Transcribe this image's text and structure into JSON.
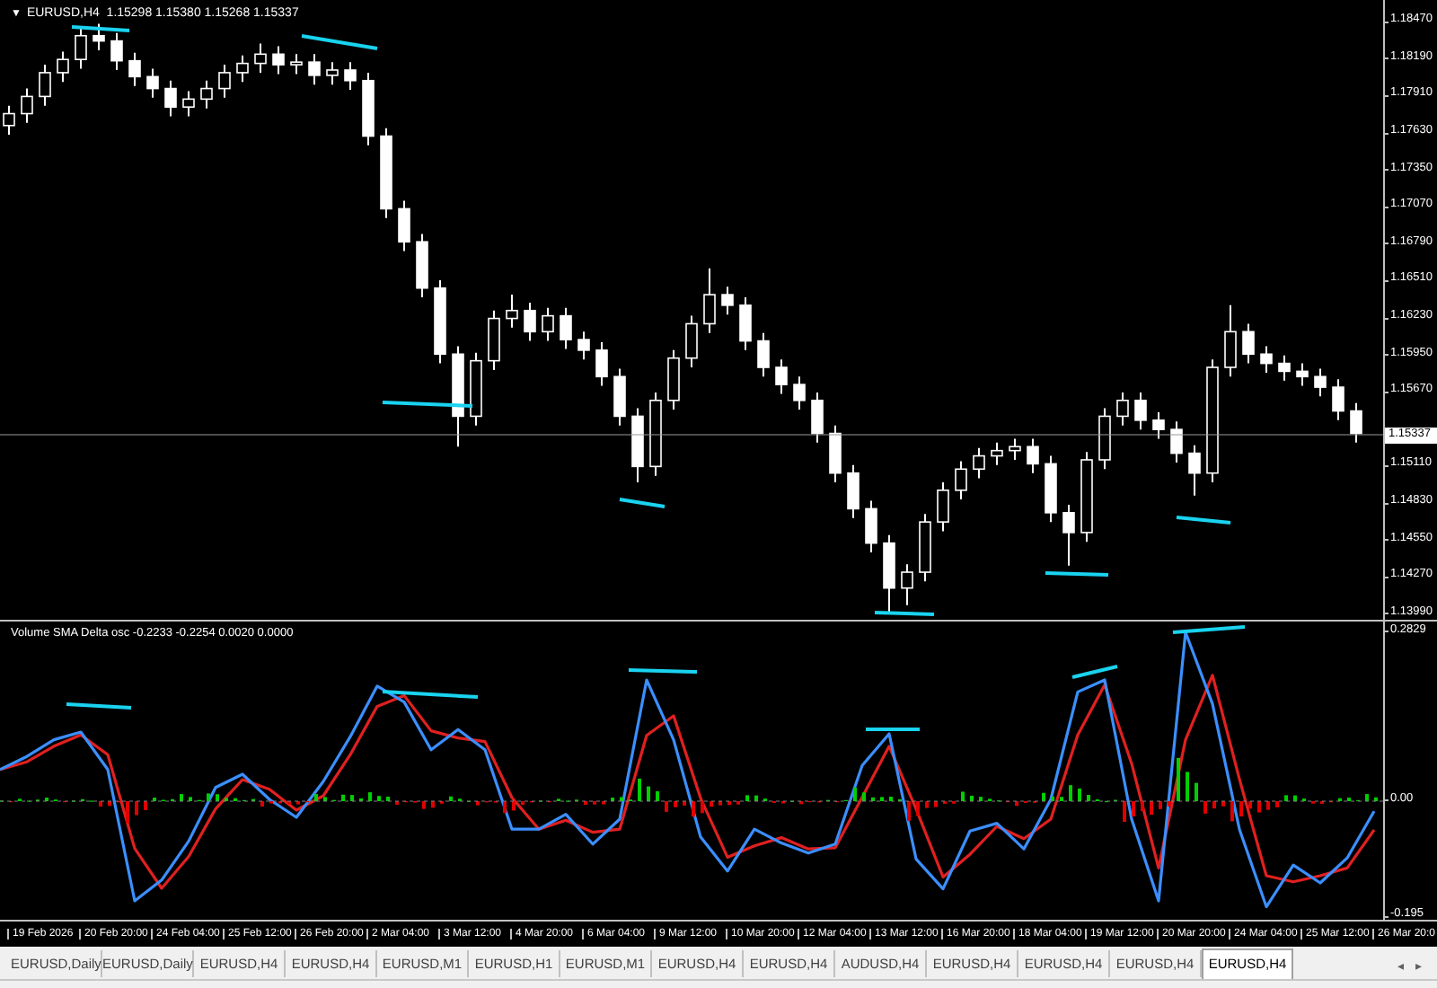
{
  "chart": {
    "symbol_caret": "▼",
    "header": "EURUSD,H4  1.15298 1.15380 1.15268 1.15337",
    "current_price": "1.15337",
    "chart_data": {
      "type": "candlestick",
      "ylim": [
        1.1394,
        1.1863
      ],
      "yticks": [
        {
          "value": 1.1847,
          "label": "1.18470"
        },
        {
          "value": 1.1819,
          "label": "1.18190"
        },
        {
          "value": 1.1791,
          "label": "1.17910"
        },
        {
          "value": 1.1763,
          "label": "1.17630"
        },
        {
          "value": 1.1735,
          "label": "1.17350"
        },
        {
          "value": 1.1707,
          "label": "1.17070"
        },
        {
          "value": 1.1679,
          "label": "1.16790"
        },
        {
          "value": 1.1651,
          "label": "1.16510"
        },
        {
          "value": 1.1623,
          "label": "1.16230"
        },
        {
          "value": 1.1595,
          "label": "1.15950"
        },
        {
          "value": 1.1567,
          "label": "1.15670"
        },
        {
          "value": 1.1511,
          "label": "1.15110"
        },
        {
          "value": 1.1483,
          "label": "1.14830"
        },
        {
          "value": 1.1455,
          "label": "1.14550"
        },
        {
          "value": 1.1427,
          "label": "1.14270"
        },
        {
          "value": 1.1399,
          "label": "1.13990"
        }
      ],
      "ohlc": [
        [
          1.1768,
          1.1783,
          1.1761,
          1.1777
        ],
        [
          1.1777,
          1.1796,
          1.177,
          1.179
        ],
        [
          1.179,
          1.1814,
          1.1783,
          1.1808
        ],
        [
          1.1808,
          1.1824,
          1.1801,
          1.1818
        ],
        [
          1.1818,
          1.1842,
          1.1811,
          1.1836
        ],
        [
          1.1836,
          1.1845,
          1.1825,
          1.1832
        ],
        [
          1.1832,
          1.1838,
          1.181,
          1.1817
        ],
        [
          1.1817,
          1.1823,
          1.1798,
          1.1805
        ],
        [
          1.1805,
          1.1811,
          1.1789,
          1.1796
        ],
        [
          1.1796,
          1.1802,
          1.1775,
          1.1782
        ],
        [
          1.1782,
          1.1794,
          1.1775,
          1.1788
        ],
        [
          1.1788,
          1.1802,
          1.1781,
          1.1796
        ],
        [
          1.1796,
          1.1814,
          1.1789,
          1.1808
        ],
        [
          1.1808,
          1.1821,
          1.1801,
          1.1815
        ],
        [
          1.1815,
          1.183,
          1.1808,
          1.1822
        ],
        [
          1.1822,
          1.1828,
          1.1807,
          1.1814
        ],
        [
          1.1814,
          1.1822,
          1.1807,
          1.1816
        ],
        [
          1.1816,
          1.1822,
          1.1799,
          1.1806
        ],
        [
          1.1806,
          1.1816,
          1.1799,
          1.181
        ],
        [
          1.181,
          1.1816,
          1.1795,
          1.1802
        ],
        [
          1.1802,
          1.1808,
          1.1753,
          1.176
        ],
        [
          1.176,
          1.1766,
          1.1698,
          1.1705
        ],
        [
          1.1705,
          1.1711,
          1.1673,
          1.168
        ],
        [
          1.168,
          1.1686,
          1.1638,
          1.1645
        ],
        [
          1.1645,
          1.1651,
          1.1588,
          1.1595
        ],
        [
          1.1595,
          1.1601,
          1.1525,
          1.1548
        ],
        [
          1.1548,
          1.1596,
          1.1541,
          1.159
        ],
        [
          1.159,
          1.1628,
          1.1583,
          1.1622
        ],
        [
          1.1622,
          1.164,
          1.1615,
          1.1628
        ],
        [
          1.1628,
          1.1634,
          1.1605,
          1.1612
        ],
        [
          1.1612,
          1.163,
          1.1605,
          1.1624
        ],
        [
          1.1624,
          1.163,
          1.1599,
          1.1606
        ],
        [
          1.1606,
          1.1612,
          1.1591,
          1.1598
        ],
        [
          1.1598,
          1.1604,
          1.1571,
          1.1578
        ],
        [
          1.1578,
          1.1584,
          1.1541,
          1.1548
        ],
        [
          1.1548,
          1.1554,
          1.1498,
          1.151
        ],
        [
          1.151,
          1.1566,
          1.1503,
          1.156
        ],
        [
          1.156,
          1.1598,
          1.1553,
          1.1592
        ],
        [
          1.1592,
          1.1624,
          1.1585,
          1.1618
        ],
        [
          1.1618,
          1.166,
          1.1611,
          1.164
        ],
        [
          1.164,
          1.1646,
          1.1625,
          1.1632
        ],
        [
          1.1632,
          1.1638,
          1.1598,
          1.1605
        ],
        [
          1.1605,
          1.1611,
          1.1578,
          1.1585
        ],
        [
          1.1585,
          1.1591,
          1.1565,
          1.1572
        ],
        [
          1.1572,
          1.1578,
          1.1553,
          1.156
        ],
        [
          1.156,
          1.1566,
          1.1528,
          1.1535
        ],
        [
          1.1535,
          1.1541,
          1.1498,
          1.1505
        ],
        [
          1.1505,
          1.1511,
          1.1471,
          1.1478
        ],
        [
          1.1478,
          1.1484,
          1.1445,
          1.1452
        ],
        [
          1.1452,
          1.1458,
          1.14,
          1.1418
        ],
        [
          1.1418,
          1.1436,
          1.1405,
          1.143
        ],
        [
          1.143,
          1.1474,
          1.1423,
          1.1468
        ],
        [
          1.1468,
          1.1498,
          1.1461,
          1.1492
        ],
        [
          1.1492,
          1.1514,
          1.1485,
          1.1508
        ],
        [
          1.1508,
          1.1524,
          1.1501,
          1.1518
        ],
        [
          1.1518,
          1.1528,
          1.1511,
          1.1522
        ],
        [
          1.1522,
          1.1531,
          1.1515,
          1.1525
        ],
        [
          1.1525,
          1.1531,
          1.1505,
          1.1512
        ],
        [
          1.1512,
          1.1518,
          1.1468,
          1.1475
        ],
        [
          1.1475,
          1.1481,
          1.1435,
          1.146
        ],
        [
          1.146,
          1.1521,
          1.1453,
          1.1515
        ],
        [
          1.1515,
          1.1554,
          1.1508,
          1.1548
        ],
        [
          1.1548,
          1.1566,
          1.1541,
          1.156
        ],
        [
          1.156,
          1.1566,
          1.1538,
          1.1545
        ],
        [
          1.1545,
          1.1551,
          1.1531,
          1.1538
        ],
        [
          1.1538,
          1.1544,
          1.1513,
          1.152
        ],
        [
          1.152,
          1.1526,
          1.1488,
          1.1505
        ],
        [
          1.1505,
          1.1591,
          1.1498,
          1.1585
        ],
        [
          1.1585,
          1.1632,
          1.1578,
          1.1612
        ],
        [
          1.1612,
          1.1618,
          1.1588,
          1.1595
        ],
        [
          1.1595,
          1.1601,
          1.1581,
          1.1588
        ],
        [
          1.1588,
          1.1594,
          1.1575,
          1.1582
        ],
        [
          1.1582,
          1.1588,
          1.1571,
          1.1578
        ],
        [
          1.1578,
          1.1584,
          1.1563,
          1.157
        ],
        [
          1.157,
          1.1576,
          1.1545,
          1.1552
        ],
        [
          1.1552,
          1.1558,
          1.1528,
          1.1535
        ]
      ]
    }
  },
  "indicator": {
    "header": "Volume SMA Delta osc -0.2233 -0.2254 0.0020 0.0000",
    "chart_data": {
      "type": "line",
      "ylim": [
        -0.195,
        0.2829
      ],
      "yticks": [
        {
          "value": 0.2829,
          "label": "0.2829"
        },
        {
          "value": 0,
          "label": "0.00"
        },
        {
          "value": -0.195,
          "label": "-0.195"
        }
      ],
      "series": [
        {
          "color": "#e02020",
          "values": [
            0.05,
            0.063,
            0.089,
            0.108,
            0.075,
            -0.082,
            -0.149,
            -0.096,
            -0.016,
            0.033,
            0.017,
            -0.018,
            0.006,
            0.075,
            0.156,
            0.174,
            0.115,
            0.103,
            0.097,
            0.003,
            -0.05,
            -0.035,
            -0.055,
            -0.05,
            0.107,
            0.14,
            0.002,
            -0.097,
            -0.078,
            -0.064,
            -0.083,
            -0.081,
            0.004,
            0.089,
            -0.016,
            -0.13,
            -0.092,
            -0.045,
            -0.066,
            -0.033,
            0.108,
            0.192,
            0.06,
            -0.115,
            0.1,
            0.208,
            0.034,
            -0.128,
            -0.138,
            -0.128,
            -0.115,
            -0.051
          ]
        },
        {
          "color": "#3b8fff",
          "values": [
            0.05,
            0.072,
            0.1,
            0.113,
            0.05,
            -0.17,
            -0.135,
            -0.07,
            0.02,
            0.042,
            0,
            -0.03,
            0.03,
            0.105,
            0.19,
            0.163,
            0.083,
            0.117,
            0.083,
            -0.05,
            -0.05,
            -0.025,
            -0.075,
            -0.033,
            0.2,
            0.1,
            -0.063,
            -0.12,
            -0.05,
            -0.073,
            -0.09,
            -0.075,
            0.057,
            0.11,
            -0.1,
            -0.15,
            -0.053,
            -0.04,
            -0.083,
            0,
            0.18,
            0.2,
            -0.033,
            -0.17,
            0.28,
            0.16,
            -0.05,
            -0.18,
            -0.11,
            -0.14,
            -0.098,
            -0.02
          ]
        }
      ]
    }
  },
  "time_axis": [
    "19 Feb 2026",
    "20 Feb 20:00",
    "24 Feb 04:00",
    "25 Feb 12:00",
    "26 Feb 20:00",
    "2 Mar 04:00",
    "3 Mar 12:00",
    "4 Mar 20:00",
    "6 Mar 04:00",
    "9 Mar 12:00",
    "10 Mar 20:00",
    "12 Mar 04:00",
    "13 Mar 12:00",
    "16 Mar 20:00",
    "18 Mar 04:00",
    "19 Mar 12:00",
    "20 Mar 20:00",
    "24 Mar 04:00",
    "25 Mar 12:00",
    "26 Mar 20:0"
  ],
  "tabs": [
    {
      "label": "EURUSD,Daily",
      "selected": false
    },
    {
      "label": "EURUSD,Daily",
      "selected": false
    },
    {
      "label": "EURUSD,H4",
      "selected": false
    },
    {
      "label": "EURUSD,H4",
      "selected": false
    },
    {
      "label": "EURUSD,M1",
      "selected": false
    },
    {
      "label": "EURUSD,H1",
      "selected": false
    },
    {
      "label": "EURUSD,M1",
      "selected": false
    },
    {
      "label": "EURUSD,H4",
      "selected": false
    },
    {
      "label": "EURUSD,H4",
      "selected": false
    },
    {
      "label": "AUDUSD,H4",
      "selected": false
    },
    {
      "label": "EURUSD,H4",
      "selected": false
    },
    {
      "label": "EURUSD,H4",
      "selected": false
    },
    {
      "label": "EURUSD,H4",
      "selected": false
    },
    {
      "label": "EURUSD,H4",
      "selected": true
    }
  ],
  "tab_scroll": [
    "◂",
    "▸"
  ]
}
